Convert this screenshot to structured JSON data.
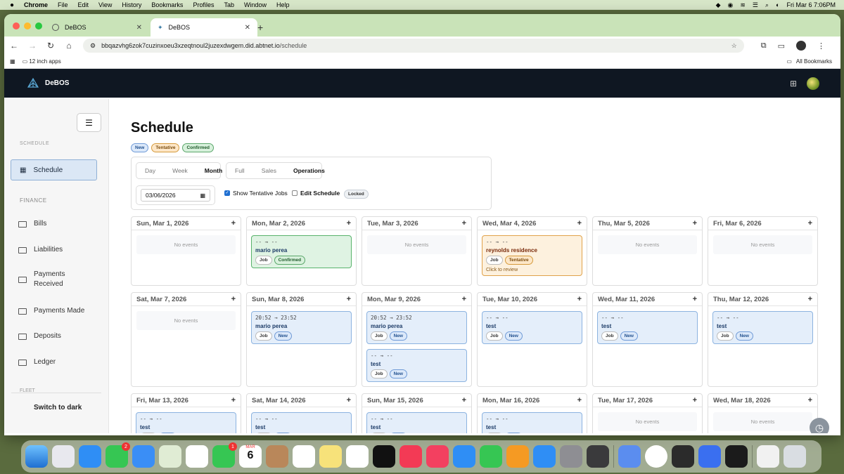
{
  "menubar": {
    "app_name": "Chrome",
    "items": [
      "File",
      "Edit",
      "View",
      "History",
      "Bookmarks",
      "Profiles",
      "Tab",
      "Window",
      "Help"
    ],
    "datetime": "Fri Mar 6  7:06PM"
  },
  "browser": {
    "tabs": [
      {
        "title": "DeBOS"
      },
      {
        "title": "DeBOS"
      }
    ],
    "url_host": "bbqazvhg6zok7cuzinxoeu3xzeqtnoul2juzexdwgem.did.abtnet.io",
    "url_path": "/schedule",
    "bookmark_folder": "12 inch apps",
    "all_bookmarks": "All Bookmarks"
  },
  "app": {
    "brand": "DeBOS"
  },
  "sidebar": {
    "section_cut": "SCHEDULE",
    "active_item": "Schedule",
    "finance_label": "FINANCE",
    "items": [
      {
        "label": "Bills"
      },
      {
        "label": "Liabilities"
      },
      {
        "label": "Payments Received"
      },
      {
        "label": "Payments Made"
      },
      {
        "label": "Deposits"
      },
      {
        "label": "Ledger"
      }
    ],
    "fleet_label": "FLEET",
    "dark_toggle": "Switch to dark"
  },
  "page": {
    "title": "Schedule",
    "legend": {
      "new": "New",
      "tentative": "Tentative",
      "confirmed": "Confirmed"
    },
    "view_tabs": [
      "Day",
      "Week",
      "Month"
    ],
    "active_view": "Month",
    "mode_tabs": [
      "Full",
      "Sales",
      "Operations"
    ],
    "active_mode": "Operations",
    "date_value": "03/06/2026",
    "show_tentative_label": "Show Tentative Jobs",
    "show_tentative_checked": true,
    "edit_schedule_label": "Edit Schedule",
    "edit_schedule_checked": false,
    "locked_badge": "Locked",
    "no_events": "No events",
    "click_to_review": "Click to review",
    "job_tag": "Job"
  },
  "calendar": {
    "rows": [
      [
        {
          "date": "Sun, Mar 1, 2026",
          "events": []
        },
        {
          "date": "Mon, Mar 2, 2026",
          "events": [
            {
              "time": "-- → --",
              "name": "mario perea",
              "status": "Confirmed"
            }
          ]
        },
        {
          "date": "Tue, Mar 3, 2026",
          "events": []
        },
        {
          "date": "Wed, Mar 4, 2026",
          "events": [
            {
              "time": "-- → --",
              "name": "reynolds residence",
              "status": "Tentative",
              "review": true
            }
          ]
        },
        {
          "date": "Thu, Mar 5, 2026",
          "events": []
        },
        {
          "date": "Fri, Mar 6, 2026",
          "events": []
        }
      ],
      [
        {
          "date": "Sat, Mar 7, 2026",
          "events": []
        },
        {
          "date": "Sun, Mar 8, 2026",
          "events": [
            {
              "time": "20:52 → 23:52",
              "name": "mario perea",
              "status": "New"
            }
          ]
        },
        {
          "date": "Mon, Mar 9, 2026",
          "events": [
            {
              "time": "20:52 → 23:52",
              "name": "mario perea",
              "status": "New"
            },
            {
              "time": "-- → --",
              "name": "test",
              "status": "New"
            }
          ]
        },
        {
          "date": "Tue, Mar 10, 2026",
          "events": [
            {
              "time": "-- → --",
              "name": "test",
              "status": "New"
            }
          ]
        },
        {
          "date": "Wed, Mar 11, 2026",
          "events": [
            {
              "time": "-- → --",
              "name": "test",
              "status": "New"
            }
          ]
        },
        {
          "date": "Thu, Mar 12, 2026",
          "events": [
            {
              "time": "-- → --",
              "name": "test",
              "status": "New"
            }
          ]
        }
      ],
      [
        {
          "date": "Fri, Mar 13, 2026",
          "events": [
            {
              "time": "-- → --",
              "name": "test",
              "status": "New"
            }
          ]
        },
        {
          "date": "Sat, Mar 14, 2026",
          "events": [
            {
              "time": "-- → --",
              "name": "test",
              "status": "New"
            }
          ]
        },
        {
          "date": "Sun, Mar 15, 2026",
          "events": [
            {
              "time": "-- → --",
              "name": "test",
              "status": "New"
            }
          ]
        },
        {
          "date": "Mon, Mar 16, 2026",
          "events": [
            {
              "time": "-- → --",
              "name": "test",
              "status": "New"
            }
          ]
        },
        {
          "date": "Tue, Mar 17, 2026",
          "events": []
        },
        {
          "date": "Wed, Mar 18, 2026",
          "events": []
        }
      ]
    ]
  },
  "dock": {
    "messages_badge": "2",
    "facetime_badge": "1",
    "calendar_month": "MAR",
    "calendar_day": "6"
  },
  "colors": {
    "header_bg": "#0f1722",
    "new": "#dce9fa",
    "tentative": "#fde7c8",
    "confirmed": "#d8f1dc"
  }
}
